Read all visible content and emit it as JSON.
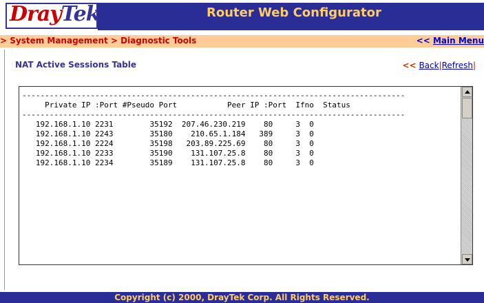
{
  "header": {
    "logo_dray": "Dray",
    "logo_tek": "Tek",
    "title": "Router Web Configurator"
  },
  "breadcrumb": {
    "path": "> System Management > Diagnostic Tools",
    "main_menu_arrow": "<<",
    "main_menu_label": "Main Menu"
  },
  "page": {
    "section_title": "NAT Active Sessions Table",
    "nav_chevron": "<<",
    "back_label": "Back",
    "separator": "|",
    "refresh_label": "Refresh",
    "separator_end": "|"
  },
  "table": {
    "divider": "------------------------------------------------------------------------------------",
    "header_line": "     Private IP :Port #Pseudo Port           Peer IP :Port  Ifno  Status",
    "columns": [
      "Private IP",
      ":Port",
      "#Pseudo Port",
      "Peer IP",
      ":Port",
      "Ifno",
      "Status"
    ],
    "rows": [
      {
        "private_ip": "192.168.1.10",
        "port": "2231",
        "pseudo_port": "35192",
        "peer_ip": "207.46.230.219",
        "peer_port": "80",
        "ifno": "3",
        "status": "0"
      },
      {
        "private_ip": "192.168.1.10",
        "port": "2243",
        "pseudo_port": "35180",
        "peer_ip": "210.65.1.184",
        "peer_port": "389",
        "ifno": "3",
        "status": "0"
      },
      {
        "private_ip": "192.168.1.10",
        "port": "2224",
        "pseudo_port": "35198",
        "peer_ip": "203.89.225.69",
        "peer_port": "80",
        "ifno": "3",
        "status": "0"
      },
      {
        "private_ip": "192.168.1.10",
        "port": "2233",
        "pseudo_port": "35190",
        "peer_ip": "131.107.25.8",
        "peer_port": "80",
        "ifno": "3",
        "status": "0"
      },
      {
        "private_ip": "192.168.1.10",
        "port": "2234",
        "pseudo_port": "35189",
        "peer_ip": "131.107.25.8",
        "peer_port": "80",
        "ifno": "3",
        "status": "0"
      }
    ]
  },
  "footer": {
    "copyright": "Copyright (c) 2000, DrayTek Corp. All Rights Reserved."
  },
  "colors": {
    "brand_blue": "#2a2d96",
    "title_gold": "#ffcc66",
    "crumb_bar": "#ffcc99",
    "link": "#0000cc",
    "accent_red": "#cc0000"
  }
}
